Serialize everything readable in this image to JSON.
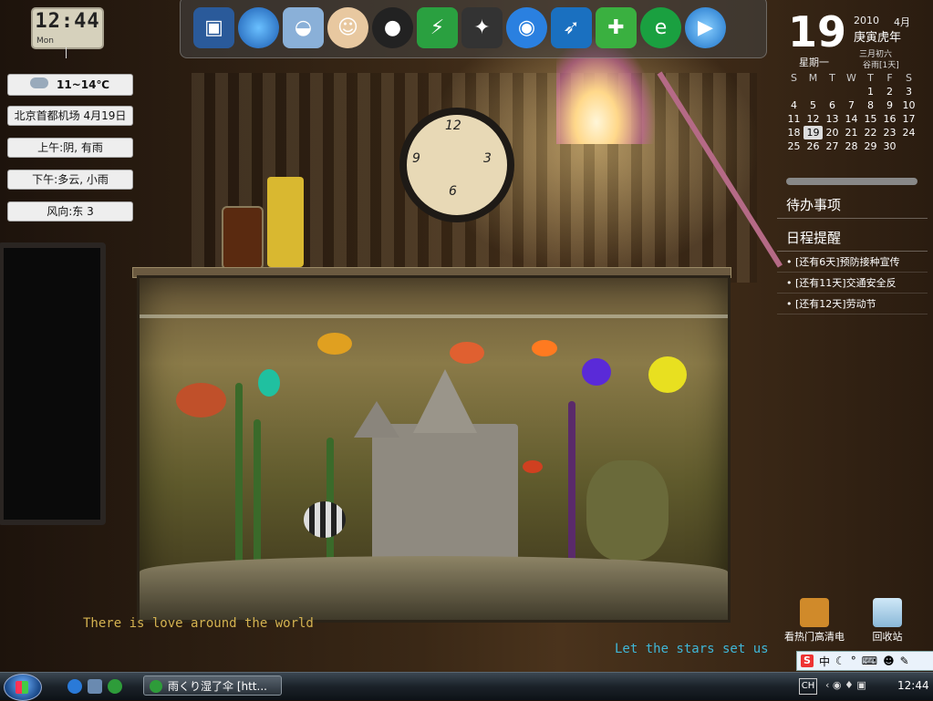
{
  "clock_widget": {
    "time": "12:44",
    "day": "Mon"
  },
  "weather": {
    "temp": "11~14℃",
    "rows": [
      "北京首都机场 4月19日",
      "上午:阴, 有雨",
      "下午:多云, 小雨",
      "风向:东 3"
    ]
  },
  "dock": {
    "icons": [
      "computer-icon",
      "network-icon",
      "media-icon",
      "user-icon",
      "qq-icon",
      "security-shield-icon",
      "counter-strike-icon",
      "qq-game-icon",
      "flight-icon",
      "health-plus-icon",
      "ie-icon",
      "play-icon"
    ]
  },
  "calendar": {
    "day": "19",
    "year": "2010",
    "month": "4月",
    "ganzhi": "庚寅虎年",
    "weekday": "星期一",
    "lunar": "三月初六",
    "solar_term": "谷雨[1天]",
    "headers": [
      "S",
      "M",
      "T",
      "W",
      "T",
      "F",
      "S"
    ],
    "weeks": [
      [
        "",
        "",
        "",
        "",
        "1",
        "2",
        "3"
      ],
      [
        "4",
        "5",
        "6",
        "7",
        "8",
        "9",
        "10"
      ],
      [
        "11",
        "12",
        "13",
        "14",
        "15",
        "16",
        "17"
      ],
      [
        "18",
        "19",
        "20",
        "21",
        "22",
        "23",
        "24"
      ],
      [
        "25",
        "26",
        "27",
        "28",
        "29",
        "30",
        ""
      ]
    ],
    "today": "19"
  },
  "todo": {
    "title": "待办事项"
  },
  "reminders": {
    "title": "日程提醒",
    "items": [
      "[还有6天]预防接种宣传",
      "[还有11天]交通安全反",
      "[还有12天]劳动节"
    ]
  },
  "lyrics": {
    "line1": "There is love around the world",
    "line2": "Let the stars set us"
  },
  "desktop_icons": [
    {
      "label": "看热门高清电",
      "icon": "hd-video-icon"
    },
    {
      "label": "回收站",
      "icon": "recycle-bin-icon"
    }
  ],
  "ime": {
    "mode": "中"
  },
  "taskbar": {
    "active_window": "雨くり湿了伞 [htt...",
    "lang": "CH",
    "time": "12:44"
  },
  "colors": {
    "lyric1": "#d4b250",
    "lyric2": "#3fb7d8",
    "taskbar": "#1b2229"
  }
}
